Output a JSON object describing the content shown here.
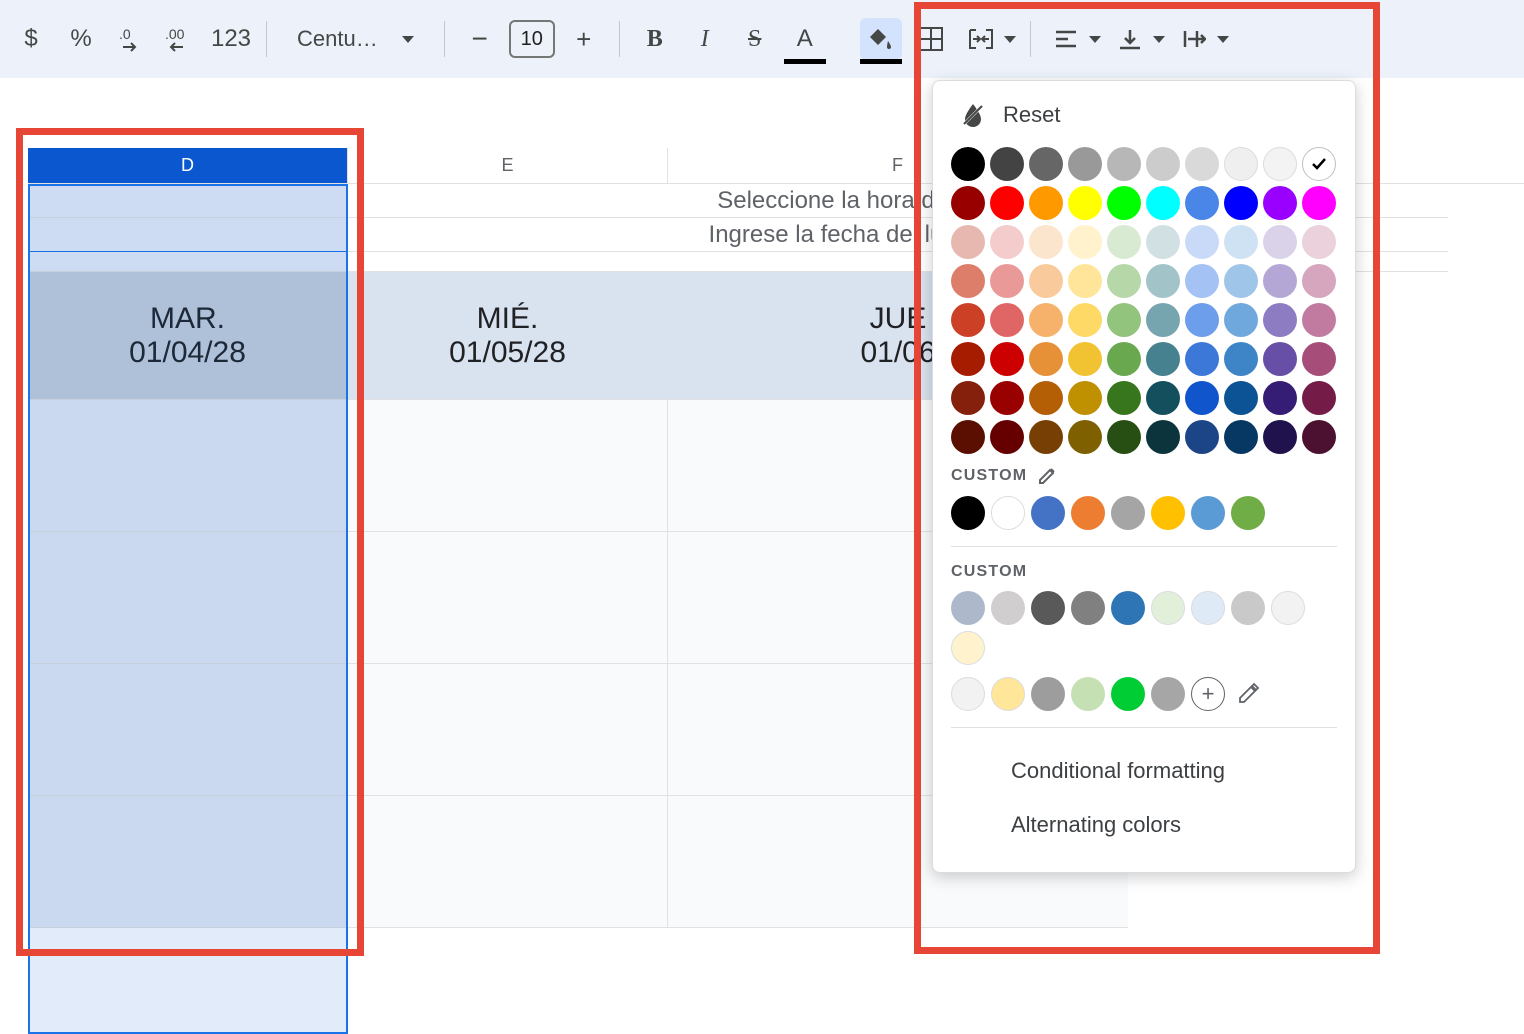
{
  "toolbar": {
    "currency": "$",
    "percent": "%",
    "dec_decrease": ".0",
    "dec_increase": ".00",
    "more_formats": "123",
    "font_name": "Centu…",
    "minus": "−",
    "font_size": "10",
    "plus": "+",
    "bold": "B",
    "italic": "I",
    "strike": "S",
    "text_color": "A"
  },
  "columns": {
    "D": "D",
    "E": "E",
    "F": "F"
  },
  "instructions": {
    "line1": "Seleccione la hora de inicio y el in",
    "line2": "Ingrese la fecha del lunes para el in"
  },
  "days": {
    "tue_label": "MAR.",
    "tue_date": "01/04/28",
    "wed_label": "MIÉ.",
    "wed_date": "01/05/28",
    "thu_label": "JUE",
    "thu_date": "01/06"
  },
  "color_panel": {
    "reset": "Reset",
    "custom_label": "CUSTOM",
    "custom_label2": "CUSTOM",
    "conditional": "Conditional formatting",
    "alternating": "Alternating colors",
    "standard_colors": [
      [
        "#000000",
        "#434343",
        "#666666",
        "#999999",
        "#b7b7b7",
        "#cccccc",
        "#d9d9d9",
        "#efefef",
        "#f3f3f3",
        "none"
      ],
      [
        "#980000",
        "#ff0000",
        "#ff9900",
        "#ffff00",
        "#00ff00",
        "#00ffff",
        "#4a86e8",
        "#0000ff",
        "#9900ff",
        "#ff00ff"
      ],
      [
        "#e6b8af",
        "#f4cccc",
        "#fce5cd",
        "#fff2cc",
        "#d9ead3",
        "#d0e0e3",
        "#c9daf8",
        "#cfe2f3",
        "#d9d2e9",
        "#ead1dc"
      ],
      [
        "#dd7e6b",
        "#ea9999",
        "#f9cb9c",
        "#ffe599",
        "#b6d7a8",
        "#a2c4c9",
        "#a4c2f4",
        "#9fc5e8",
        "#b4a7d6",
        "#d5a6bd"
      ],
      [
        "#cc4125",
        "#e06666",
        "#f6b26b",
        "#ffd966",
        "#93c47d",
        "#76a5af",
        "#6d9eeb",
        "#6fa8dc",
        "#8e7cc3",
        "#c27ba0"
      ],
      [
        "#a61c00",
        "#cc0000",
        "#e69138",
        "#f1c232",
        "#6aa84f",
        "#45818e",
        "#3c78d8",
        "#3d85c6",
        "#674ea7",
        "#a64d79"
      ],
      [
        "#85200c",
        "#990000",
        "#b45f06",
        "#bf9000",
        "#38761d",
        "#134f5c",
        "#1155cc",
        "#0b5394",
        "#351c75",
        "#741b47"
      ],
      [
        "#5b0f00",
        "#660000",
        "#783f04",
        "#7f6000",
        "#274e13",
        "#0c343d",
        "#1c4587",
        "#073763",
        "#20124d",
        "#4c1130"
      ]
    ],
    "custom_colors1": [
      "#000000",
      "#ffffff",
      "#4472c4",
      "#ed7d31",
      "#a5a5a5",
      "#ffc000",
      "#5b9bd5",
      "#70ad47"
    ],
    "custom_colors2": [
      "#adb9ca",
      "#d0cece",
      "#595959",
      "#808080",
      "#2e75b6",
      "#e2efd9",
      "#deeaf6",
      "#c9c9c9",
      "#f2f2f2",
      "#fff2cc",
      "#f2f2f2",
      "#ffe699",
      "#9d9d9d",
      "#c5e0b3",
      "#00cc33",
      "#a6a6a6"
    ]
  }
}
